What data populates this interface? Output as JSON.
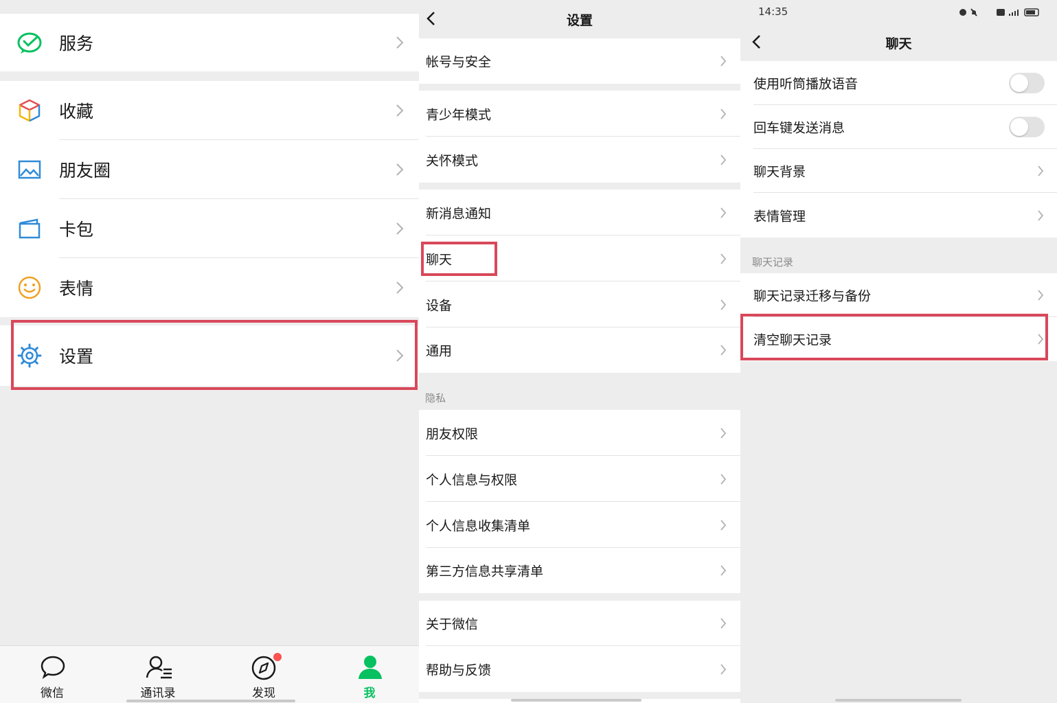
{
  "colors": {
    "accent": "#07c160",
    "highlight": "#d9485a",
    "badge": "#fa5151"
  },
  "me_menu": {
    "items": [
      {
        "label": "服务",
        "icon": "wechat-pay-icon"
      },
      {
        "label": "收藏",
        "icon": "favorites-cube-icon"
      },
      {
        "label": "朋友圈",
        "icon": "moments-picture-icon"
      },
      {
        "label": "卡包",
        "icon": "card-wallet-icon"
      },
      {
        "label": "表情",
        "icon": "smiley-face-icon"
      },
      {
        "label": "设置",
        "icon": "gear-icon"
      }
    ]
  },
  "tabbar": {
    "tabs": [
      {
        "label": "微信",
        "icon": "chat-bubble-icon"
      },
      {
        "label": "通讯录",
        "icon": "contacts-icon"
      },
      {
        "label": "发现",
        "icon": "compass-icon"
      },
      {
        "label": "我",
        "icon": "person-icon"
      }
    ]
  },
  "settings": {
    "title": "设置",
    "items": [
      {
        "label": "帐号与安全"
      },
      {
        "label": "青少年模式"
      },
      {
        "label": "关怀模式"
      },
      {
        "label": "新消息通知"
      },
      {
        "label": "聊天"
      },
      {
        "label": "设备"
      },
      {
        "label": "通用"
      },
      {
        "label": "朋友权限"
      },
      {
        "label": "个人信息与权限"
      },
      {
        "label": "个人信息收集清单"
      },
      {
        "label": "第三方信息共享清单"
      },
      {
        "label": "关于微信"
      },
      {
        "label": "帮助与反馈"
      }
    ],
    "privacy_section": "隐私"
  },
  "chat": {
    "status_time": "14:35",
    "title": "聊天",
    "items": [
      {
        "label": "使用听筒播放语音",
        "toggle_on": false
      },
      {
        "label": "回车键发送消息",
        "toggle_on": false
      },
      {
        "label": "聊天背景"
      },
      {
        "label": "表情管理"
      },
      {
        "label": "聊天记录迁移与备份"
      },
      {
        "label": "清空聊天记录"
      }
    ],
    "history_section": "聊天记录"
  }
}
